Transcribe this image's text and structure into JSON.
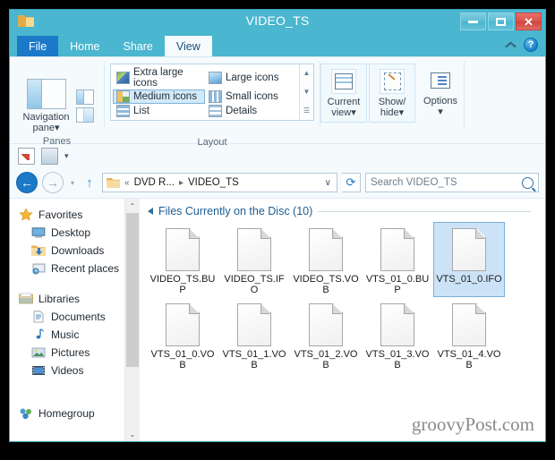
{
  "window": {
    "title": "VIDEO_TS",
    "folder_icon": "folder-icon",
    "controls": {
      "minimize": "–",
      "maximize": "□",
      "close": "✕"
    }
  },
  "tabs": [
    {
      "label": "File",
      "state": "file"
    },
    {
      "label": "Home",
      "state": "normal"
    },
    {
      "label": "Share",
      "state": "normal"
    },
    {
      "label": "View",
      "state": "active"
    }
  ],
  "tab_right": {
    "collapse": "collapse-ribbon-icon",
    "help": "?"
  },
  "ribbon": {
    "panes": {
      "group_label": "Panes",
      "nav_pane_label": "Navigation\npane",
      "nav_pane_line1": "Navigation",
      "nav_pane_line2": "pane",
      "caret": "▾"
    },
    "layout": {
      "group_label": "Layout",
      "items": [
        {
          "label": "Extra large icons",
          "selected": false,
          "icon": "extra-large-icons-icon"
        },
        {
          "label": "Large icons",
          "selected": false,
          "icon": "large-icons-icon"
        },
        {
          "label": "Medium icons",
          "selected": true,
          "icon": "medium-icons-icon"
        },
        {
          "label": "Small icons",
          "selected": false,
          "icon": "small-icons-icon"
        },
        {
          "label": "List",
          "selected": false,
          "icon": "list-icon"
        },
        {
          "label": "Details",
          "selected": false,
          "icon": "details-icon"
        }
      ],
      "scroll_up": "▲",
      "scroll_down": "▼",
      "scroll_more": "☰"
    },
    "buttons": [
      {
        "line1": "Current",
        "line2": "view",
        "caret": "▾",
        "icon": "current-view-icon",
        "framed": true
      },
      {
        "line1": "Show/",
        "line2": "hide",
        "caret": "▾",
        "icon": "show-hide-icon",
        "framed": true
      },
      {
        "line1": "Options",
        "line2": "",
        "caret": "▾",
        "icon": "options-icon",
        "framed": false
      }
    ]
  },
  "quick_access": {
    "properties_icon": "properties-icon",
    "new_folder_icon": "new-folder-icon",
    "dropdown": "▾"
  },
  "address": {
    "back": "←",
    "forward": "→",
    "history_caret": "▾",
    "up": "↑",
    "folder_icon": "folder-icon",
    "crumb_overflow": "«",
    "crumb_drive": "DVD R...",
    "crumb_sep": "▸",
    "crumb_current": "VIDEO_TS",
    "path_caret": "∨",
    "refresh": "⟳",
    "search_placeholder": "Search VIDEO_TS",
    "search_value": "",
    "search_icon": "search-icon"
  },
  "sidebar": {
    "sections": [
      {
        "header": {
          "label": "Favorites",
          "icon": "star-icon"
        },
        "items": [
          {
            "label": "Desktop",
            "icon": "desktop-icon"
          },
          {
            "label": "Downloads",
            "icon": "downloads-icon"
          },
          {
            "label": "Recent places",
            "icon": "recent-places-icon"
          }
        ]
      },
      {
        "header": {
          "label": "Libraries",
          "icon": "libraries-icon"
        },
        "items": [
          {
            "label": "Documents",
            "icon": "documents-icon"
          },
          {
            "label": "Music",
            "icon": "music-icon"
          },
          {
            "label": "Pictures",
            "icon": "pictures-icon"
          },
          {
            "label": "Videos",
            "icon": "videos-icon"
          }
        ]
      },
      {
        "header": {
          "label": "Homegroup",
          "icon": "homegroup-icon"
        },
        "items": []
      }
    ],
    "scroll": {
      "up": "⌃",
      "down": "⌄"
    }
  },
  "files": {
    "group_header": "Files Currently on the Disc (10)",
    "items": [
      {
        "name": "VIDEO_TS.BUP",
        "selected": false
      },
      {
        "name": "VIDEO_TS.IFO",
        "selected": false
      },
      {
        "name": "VIDEO_TS.VOB",
        "selected": false
      },
      {
        "name": "VTS_01_0.BUP",
        "selected": false
      },
      {
        "name": "VTS_01_0.IFO",
        "selected": true
      },
      {
        "name": "VTS_01_0.VOB",
        "selected": false
      },
      {
        "name": "VTS_01_1.VOB",
        "selected": false
      },
      {
        "name": "VTS_01_2.VOB",
        "selected": false
      },
      {
        "name": "VTS_01_3.VOB",
        "selected": false
      },
      {
        "name": "VTS_01_4.VOB",
        "selected": false
      }
    ]
  },
  "watermark": "groovyPost.com",
  "colors": {
    "frame": "#4ab6cf",
    "file_tab": "#1b79c8",
    "active_tab_bg": "#f5fafd",
    "selection": "#cce3f7",
    "selection_border": "#7aadd8",
    "group_header_text": "#1c5c93",
    "close_button": "#da514a"
  }
}
